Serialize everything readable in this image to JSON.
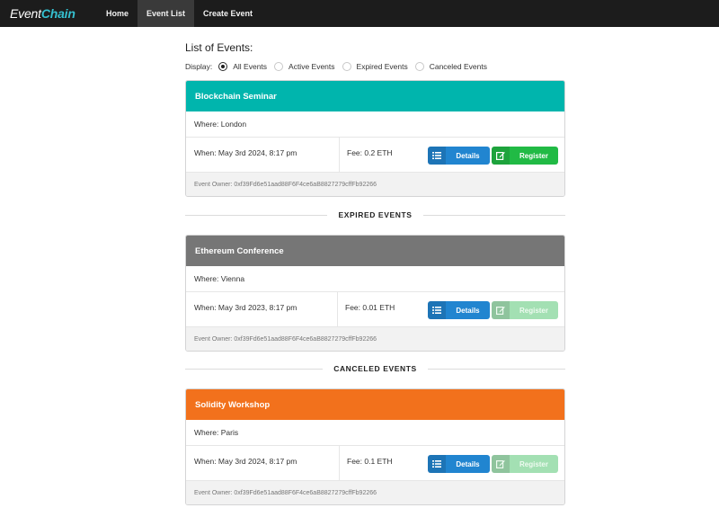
{
  "brand": {
    "part1": "Event",
    "part2": "Chain"
  },
  "nav": {
    "home": "Home",
    "event_list": "Event List",
    "create_event": "Create Event"
  },
  "page": {
    "title": "List of Events:",
    "display_label": "Display:",
    "filters": [
      "All Events",
      "Active Events",
      "Expired Events",
      "Canceled Events"
    ],
    "selected_filter": "All Events"
  },
  "buttons": {
    "details": "Details",
    "register": "Register"
  },
  "dividers": {
    "expired": "EXPIRED EVENTS",
    "canceled": "CANCELED EVENTS"
  },
  "events": [
    {
      "name": "Blockchain Seminar",
      "where": "Where: London",
      "when": "When: May 3rd 2024, 8:17 pm",
      "fee": "Fee: 0.2 ETH",
      "owner": "Event Owner: 0xf39Fd6e51aad88F6F4ce6aB8827279cffFb92266",
      "header_color": "#00b5ad",
      "register_enabled": true
    },
    {
      "name": "Ethereum Conference",
      "where": "Where: Vienna",
      "when": "When: May 3rd 2023, 8:17 pm",
      "fee": "Fee: 0.01 ETH",
      "owner": "Event Owner: 0xf39Fd6e51aad88F6F4ce6aB8827279cffFb92266",
      "header_color": "#767676",
      "register_enabled": false
    },
    {
      "name": "Solidity Workshop",
      "where": "Where: Paris",
      "when": "When: May 3rd 2024, 8:17 pm",
      "fee": "Fee: 0.1 ETH",
      "owner": "Event Owner: 0xf39Fd6e51aad88F6F4ce6aB8827279cffFb92266",
      "header_color": "#f2711c",
      "register_enabled": false
    }
  ],
  "colors": {
    "details_button": "#2185d0",
    "register_button": "#21ba45",
    "register_disabled": "#a3e0b3",
    "navbar": "#1c1c1c"
  },
  "icons": {
    "details": "list-icon",
    "register": "edit-icon"
  }
}
